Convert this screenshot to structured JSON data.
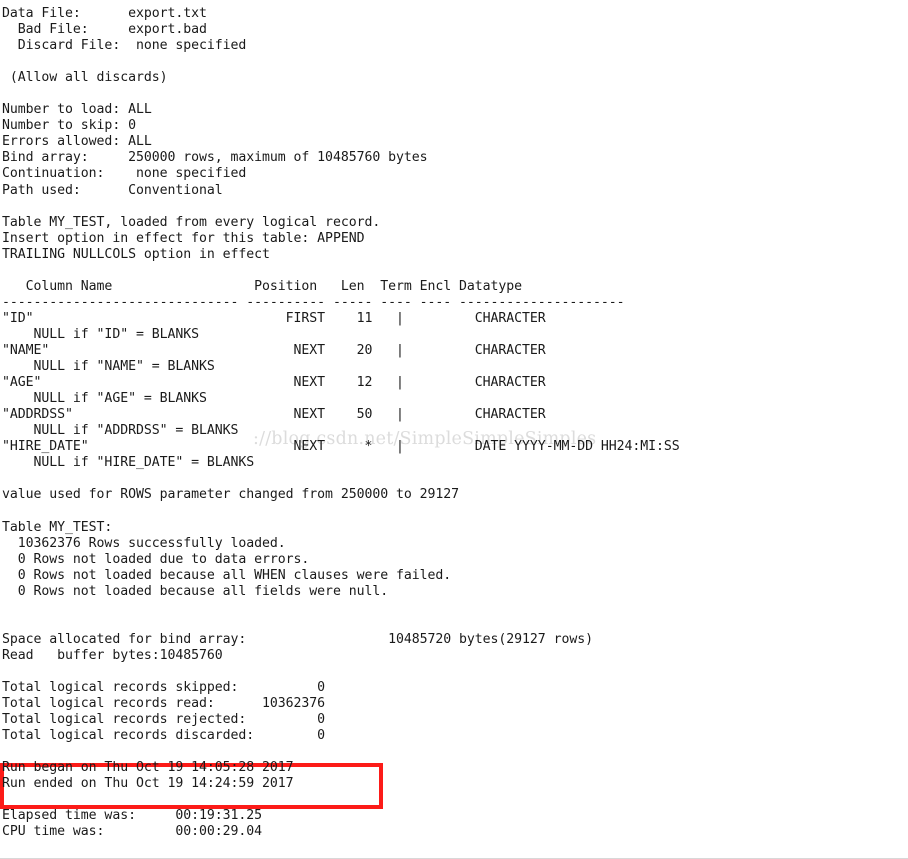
{
  "document": {
    "kind": "sqlloader-log",
    "title": "SQL*Loader log output",
    "text_color": "#1a1a1a",
    "background_color": "#ffffff"
  },
  "watermark": {
    "text": "://blog.csdn.net/SimpleSimpleSimples",
    "color": "#dcdcdc"
  },
  "annotation": {
    "type": "rectangle",
    "color": "#fc1b18",
    "border_width_px": 4,
    "covers_lines": [
      "Run began on Thu Oct 19 14:05:28 2017",
      "Run ended on Thu Oct 19 14:24:59 2017"
    ]
  },
  "header": {
    "data_file_label": "Data File:",
    "data_file_value": "export.txt",
    "bad_file_label": "Bad File:",
    "bad_file_value": "export.bad",
    "discard_file_label": "Discard File:",
    "discard_file_value": "none specified",
    "discard_note": "(Allow all discards)"
  },
  "options": {
    "number_to_load_label": "Number to load:",
    "number_to_load_value": "ALL",
    "number_to_skip_label": "Number to skip:",
    "number_to_skip_value": "0",
    "errors_allowed_label": "Errors allowed:",
    "errors_allowed_value": "ALL",
    "bind_array_label": "Bind array:",
    "bind_array_value": "250000 rows, maximum of 10485760 bytes",
    "continuation_label": "Continuation:",
    "continuation_value": "none specified",
    "path_used_label": "Path used:",
    "path_used_value": "Conventional"
  },
  "table_info": {
    "table_line": "Table MY_TEST, loaded from every logical record.",
    "insert_option_line": "Insert option in effect for this table: APPEND",
    "trailing_nullcols_line": "TRAILING NULLCOLS option in effect",
    "table_name": "MY_TEST"
  },
  "columns": {
    "headers": [
      "Column Name",
      "Position",
      "Len",
      "Term",
      "Encl",
      "Datatype"
    ],
    "separator": "------------------------------ ---------- ----- ---- ---- ---------------------",
    "rows": [
      {
        "name": "\"ID\"",
        "position": "FIRST",
        "len": "11",
        "term": "|",
        "encl": "",
        "datatype": "CHARACTER",
        "null_if": "    NULL if \"ID\" = BLANKS"
      },
      {
        "name": "\"NAME\"",
        "position": "NEXT",
        "len": "20",
        "term": "|",
        "encl": "",
        "datatype": "CHARACTER",
        "null_if": "    NULL if \"NAME\" = BLANKS"
      },
      {
        "name": "\"AGE\"",
        "position": "NEXT",
        "len": "12",
        "term": "|",
        "encl": "",
        "datatype": "CHARACTER",
        "null_if": "    NULL if \"AGE\" = BLANKS"
      },
      {
        "name": "\"ADDRDSS\"",
        "position": "NEXT",
        "len": "50",
        "term": "|",
        "encl": "",
        "datatype": "CHARACTER",
        "null_if": "    NULL if \"ADDRDSS\" = BLANKS"
      },
      {
        "name": "\"HIRE_DATE\"",
        "position": "NEXT",
        "len": "*",
        "term": "|",
        "encl": "",
        "datatype": "DATE YYYY-MM-DD HH24:MI:SS",
        "null_if": "    NULL if \"HIRE_DATE\" = BLANKS"
      }
    ]
  },
  "rows_notice": "value used for ROWS parameter changed from 250000 to 29127",
  "load_summary": {
    "table_heading": "Table MY_TEST:",
    "rows_loaded": "  10362376 Rows successfully loaded.",
    "rows_data_errors": "  0 Rows not loaded due to data errors.",
    "rows_when_failed": "  0 Rows not loaded because all WHEN clauses were failed.",
    "rows_all_null": "  0 Rows not loaded because all fields were null."
  },
  "memory": {
    "space_allocated_label": "Space allocated for bind array:",
    "space_allocated_value": "10485720 bytes(29127 rows)",
    "read_buffer_line": "Read   buffer bytes:10485760"
  },
  "totals": {
    "skipped_label": "Total logical records skipped:",
    "skipped_value": "0",
    "read_label": "Total logical records read:",
    "read_value": "10362376",
    "rejected_label": "Total logical records rejected:",
    "rejected_value": "0",
    "discarded_label": "Total logical records discarded:",
    "discarded_value": "0"
  },
  "run_times": {
    "began_line": "Run began on Thu Oct 19 14:05:28 2017",
    "ended_line": "Run ended on Thu Oct 19 14:24:59 2017",
    "elapsed_label": "Elapsed time was:",
    "elapsed_value": "00:19:31.25",
    "cpu_label": "CPU time was:",
    "cpu_value": "00:00:29.04"
  },
  "raw_log": "Data File:      export.txt\n  Bad File:     export.bad\n  Discard File:  none specified\n \n (Allow all discards)\n\nNumber to load: ALL\nNumber to skip: 0\nErrors allowed: ALL\nBind array:     250000 rows, maximum of 10485760 bytes\nContinuation:    none specified\nPath used:      Conventional\n\nTable MY_TEST, loaded from every logical record.\nInsert option in effect for this table: APPEND\nTRAILING NULLCOLS option in effect\n\n   Column Name                  Position   Len  Term Encl Datatype\n------------------------------ ---------- ----- ---- ---- ---------------------\n\"ID\"                                FIRST    11   |         CHARACTER\n    NULL if \"ID\" = BLANKS\n\"NAME\"                               NEXT    20   |         CHARACTER\n    NULL if \"NAME\" = BLANKS\n\"AGE\"                                NEXT    12   |         CHARACTER\n    NULL if \"AGE\" = BLANKS\n\"ADDRDSS\"                            NEXT    50   |         CHARACTER\n    NULL if \"ADDRDSS\" = BLANKS\n\"HIRE_DATE\"                          NEXT     *   |         DATE YYYY-MM-DD HH24:MI:SS\n    NULL if \"HIRE_DATE\" = BLANKS\n\nvalue used for ROWS parameter changed from 250000 to 29127\n\nTable MY_TEST:\n  10362376 Rows successfully loaded.\n  0 Rows not loaded due to data errors.\n  0 Rows not loaded because all WHEN clauses were failed.\n  0 Rows not loaded because all fields were null.\n\n\nSpace allocated for bind array:                  10485720 bytes(29127 rows)\nRead   buffer bytes:10485760\n\nTotal logical records skipped:          0\nTotal logical records read:      10362376\nTotal logical records rejected:         0\nTotal logical records discarded:        0\n\nRun began on Thu Oct 19 14:05:28 2017\nRun ended on Thu Oct 19 14:24:59 2017\n\nElapsed time was:     00:19:31.25\nCPU time was:         00:00:29.04"
}
